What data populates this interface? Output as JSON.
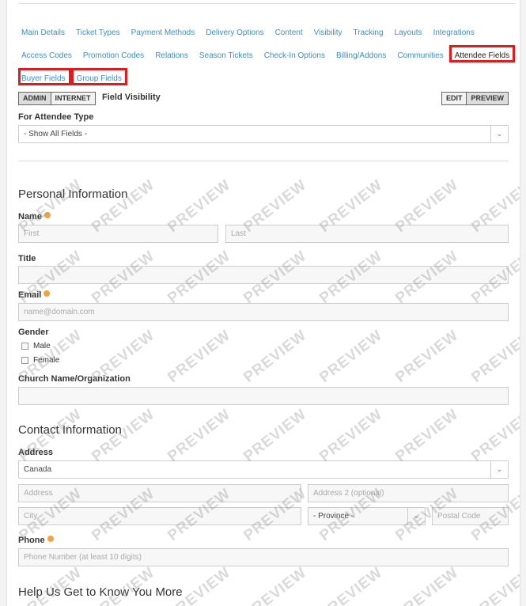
{
  "tabs_row1": [
    "Main Details",
    "Ticket Types",
    "Payment Methods",
    "Delivery Options",
    "Content",
    "Visibility",
    "Tracking",
    "Layouts",
    "Integrations"
  ],
  "tabs_row2": [
    "Access Codes",
    "Promotion Codes",
    "Relations",
    "Season Tickets",
    "Check-In Options",
    "Billing/Addons",
    "Communities",
    "Attendee Fields"
  ],
  "tabs_row3": [
    "Buyer Fields",
    "Group Fields"
  ],
  "toolbar": {
    "admin": "ADMIN",
    "internet": "INTERNET",
    "field_visibility": "Field Visibility",
    "edit": "EDIT",
    "preview": "PREVIEW"
  },
  "attendee_type": {
    "label": "For Attendee Type",
    "value": "- Show All Fields -"
  },
  "personal": {
    "heading": "Personal Information",
    "name_label": "Name",
    "first_ph": "First",
    "last_ph": "Last",
    "title_label": "Title",
    "email_label": "Email",
    "email_ph": "name@domain.com",
    "gender_label": "Gender",
    "male": "Male",
    "female": "Female",
    "church_label": "Church Name/Organization"
  },
  "contact": {
    "heading": "Contact Information",
    "address_label": "Address",
    "country": "Canada",
    "address_ph": "Address",
    "address2_ph": "Address 2 (optional)",
    "city_ph": "City",
    "province": "- Province -",
    "postal_ph": "Postal Code",
    "phone_label": "Phone",
    "phone_ph": "Phone Number (at least 10 digits)"
  },
  "more": {
    "heading": "Help Us Get to Know You More"
  },
  "watermark": "PREVIEW",
  "colors": {
    "link": "#3d8fc1",
    "highlight": "#e01b1b",
    "required": "#f0a43a"
  }
}
